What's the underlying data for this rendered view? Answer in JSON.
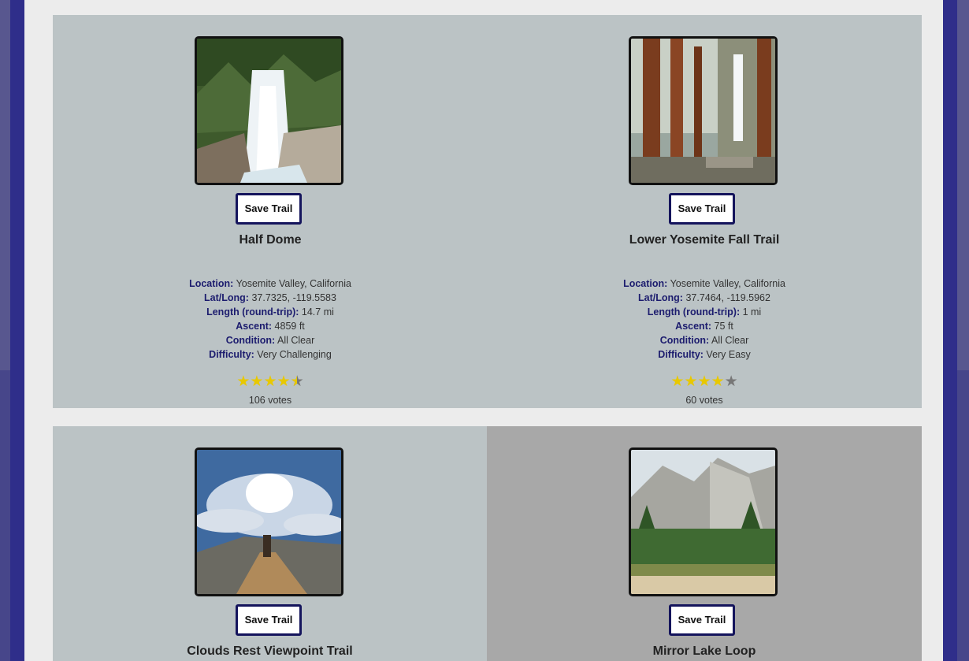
{
  "trails": [
    {
      "name": "Half Dome",
      "save_label": "Save Trail",
      "location_label": "Location:",
      "location": "Yosemite Valley, California",
      "latlong_label": "Lat/Long:",
      "latlong": "37.7325, -119.5583",
      "length_label": "Length (round-trip):",
      "length": "14.7 mi",
      "ascent_label": "Ascent:",
      "ascent": "4859 ft",
      "condition_label": "Condition:",
      "condition": "All Clear",
      "difficulty_label": "Difficulty:",
      "difficulty": "Very Challenging",
      "rating": 4.5,
      "votes": "106 votes"
    },
    {
      "name": "Lower Yosemite Fall Trail",
      "save_label": "Save Trail",
      "location_label": "Location:",
      "location": "Yosemite Valley, California",
      "latlong_label": "Lat/Long:",
      "latlong": "37.7464, -119.5962",
      "length_label": "Length (round-trip):",
      "length": "1 mi",
      "ascent_label": "Ascent:",
      "ascent": "75 ft",
      "condition_label": "Condition:",
      "condition": "All Clear",
      "difficulty_label": "Difficulty:",
      "difficulty": "Very Easy",
      "rating": 4,
      "votes": "60 votes"
    },
    {
      "name": "Clouds Rest Viewpoint Trail",
      "save_label": "Save Trail"
    },
    {
      "name": "Mirror Lake Loop",
      "save_label": "Save Trail"
    }
  ],
  "colors": {
    "page_background": "#2f2e8a",
    "card_background": "#bbc3c5",
    "card_background_alt": "#a8a8a8",
    "label_color": "#1c1c6e",
    "star_color": "#e8c800"
  },
  "icons": {
    "star": "star-icon"
  }
}
